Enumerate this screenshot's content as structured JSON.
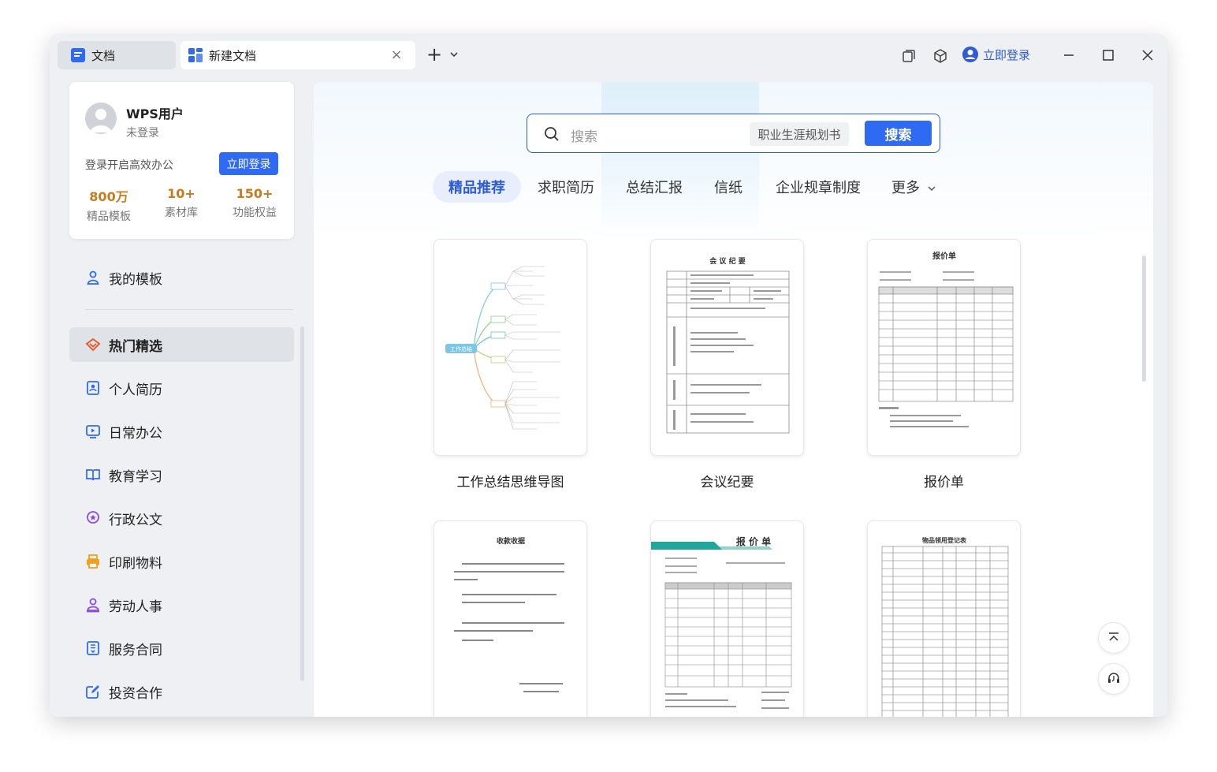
{
  "tabs": [
    {
      "label": "文档",
      "icon": "docs-icon"
    },
    {
      "label": "新建文档",
      "icon": "grid-doc-icon"
    }
  ],
  "titlebar": {
    "login_label": "立即登录",
    "icons": [
      "plus-icon",
      "chevron-down-icon",
      "restore-windows-icon",
      "cube-icon",
      "user-circle-icon",
      "minimize-icon",
      "maximize-icon",
      "close-icon"
    ]
  },
  "user": {
    "name": "WPS用户",
    "status": "未登录",
    "promo": "登录开启高效办公",
    "login_button": "立即登录",
    "stats": [
      {
        "value": "800万",
        "label": "精品模板"
      },
      {
        "value": "10+",
        "label": "素材库"
      },
      {
        "value": "150+",
        "label": "功能权益"
      }
    ]
  },
  "sidebar": {
    "my_templates": "我的模板",
    "items": [
      {
        "label": "热门精选",
        "icon": "hot-diamond-icon",
        "active": true
      },
      {
        "label": "个人简历",
        "icon": "resume-icon"
      },
      {
        "label": "日常办公",
        "icon": "office-icon"
      },
      {
        "label": "教育学习",
        "icon": "book-icon"
      },
      {
        "label": "行政公文",
        "icon": "badge-icon"
      },
      {
        "label": "印刷物料",
        "icon": "printer-icon"
      },
      {
        "label": "劳动人事",
        "icon": "person-icon"
      },
      {
        "label": "服务合同",
        "icon": "contract-icon"
      },
      {
        "label": "投资合作",
        "icon": "edit-icon"
      }
    ]
  },
  "search": {
    "placeholder": "搜索",
    "hint": "职业生涯规划书",
    "button": "搜索"
  },
  "categories": [
    {
      "label": "精品推荐",
      "active": true
    },
    {
      "label": "求职简历"
    },
    {
      "label": "总结汇报"
    },
    {
      "label": "信纸"
    },
    {
      "label": "企业规章制度"
    },
    {
      "label": "更多"
    }
  ],
  "templates": [
    {
      "title": "工作总结思维导图",
      "thumb_label": "工作总结"
    },
    {
      "title": "会议纪要",
      "thumb_label": "会 议 纪 要"
    },
    {
      "title": "报价单",
      "thumb_label": "报价单"
    },
    {
      "title": "",
      "thumb_label": "收款收据"
    },
    {
      "title": "",
      "thumb_label": "报 价 单"
    },
    {
      "title": "",
      "thumb_label": "物品领用登记表"
    }
  ],
  "colors": {
    "accent": "#2f6bf2",
    "stat": "#c87a1e",
    "teal": "#1fa89a"
  }
}
